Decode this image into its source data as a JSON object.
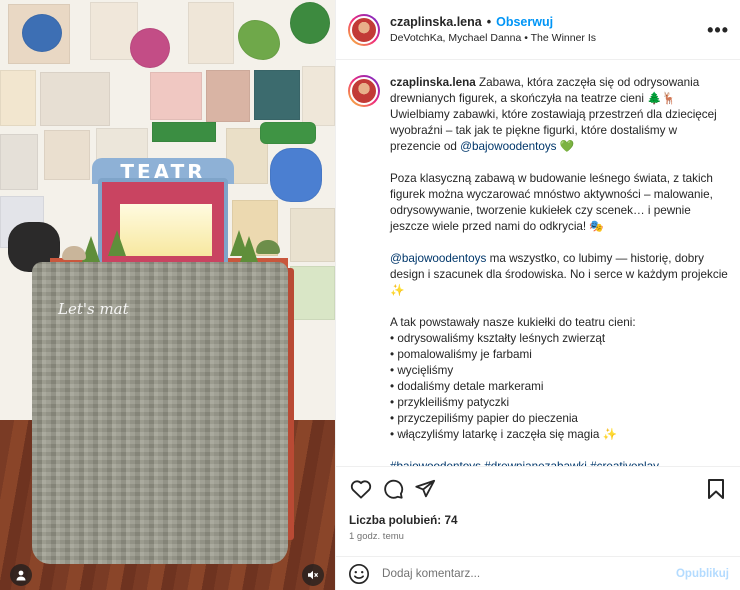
{
  "header": {
    "username": "czaplinska.lena",
    "separator": "•",
    "follow_label": "Obserwuj",
    "audio": "DeVotchKa, Mychael Danna • The Winner Is",
    "more_label": "•••"
  },
  "media": {
    "sign_text": "TEATR",
    "watermark": "Let's mat"
  },
  "caption": {
    "username": "czaplinska.lena",
    "p1_text": "Zabawa, która zaczęła się od odrysowania drewnianych figurek, a skończyła na teatrze cieni 🌲🦌 Uwielbiamy zabawki, które zostawiają przestrzeń dla dziecięcej wyobraźni – tak jak te piękne figurki, które dostaliśmy w prezencie od ",
    "p1_mention": "@bajowoodentoys",
    "p1_emoji": " 💚",
    "p2": "Poza klasyczną zabawą w budowanie leśnego świata, z takich figurek można wyczarować mnóstwo aktywności – malowanie, odrysowywanie, tworzenie kukiełek czy scenek… i pewnie jeszcze wiele przed nami do odkrycia! 🎭",
    "p3_mention": "@bajowoodentoys",
    "p3_text": " ma wszystko, co lubimy — historię, dobry design i szacunek dla środowiska. No i serce w każdym projekcie ✨",
    "p4_intro": "A tak powstawały nasze kukiełki do teatru cieni:",
    "steps": [
      "• odrysowaliśmy kształty leśnych zwierząt",
      "• pomalowaliśmy je farbami",
      "• wycięliśmy",
      "• dodaliśmy detale markerami",
      "• przykleiliśmy patyczki",
      "• przyczepiliśmy papier do pieczenia",
      "• włączyliśmy latarkę i zaczęła się magia ✨"
    ],
    "hashtags": "#bajowoodentoys #drewnianezabawki #creativeplay #czaszdzieckiem #diyforkids #kreatywnezabawy #dladzieci"
  },
  "footer": {
    "likes": "Liczba polubień: 74",
    "time": "1 godz. temu",
    "comment_placeholder": "Dodaj komentarz...",
    "publish_label": "Opublikuj"
  },
  "colors": {
    "accent": "#0095f6",
    "mention": "#00376b",
    "publish_disabled": "#b3dbff"
  }
}
